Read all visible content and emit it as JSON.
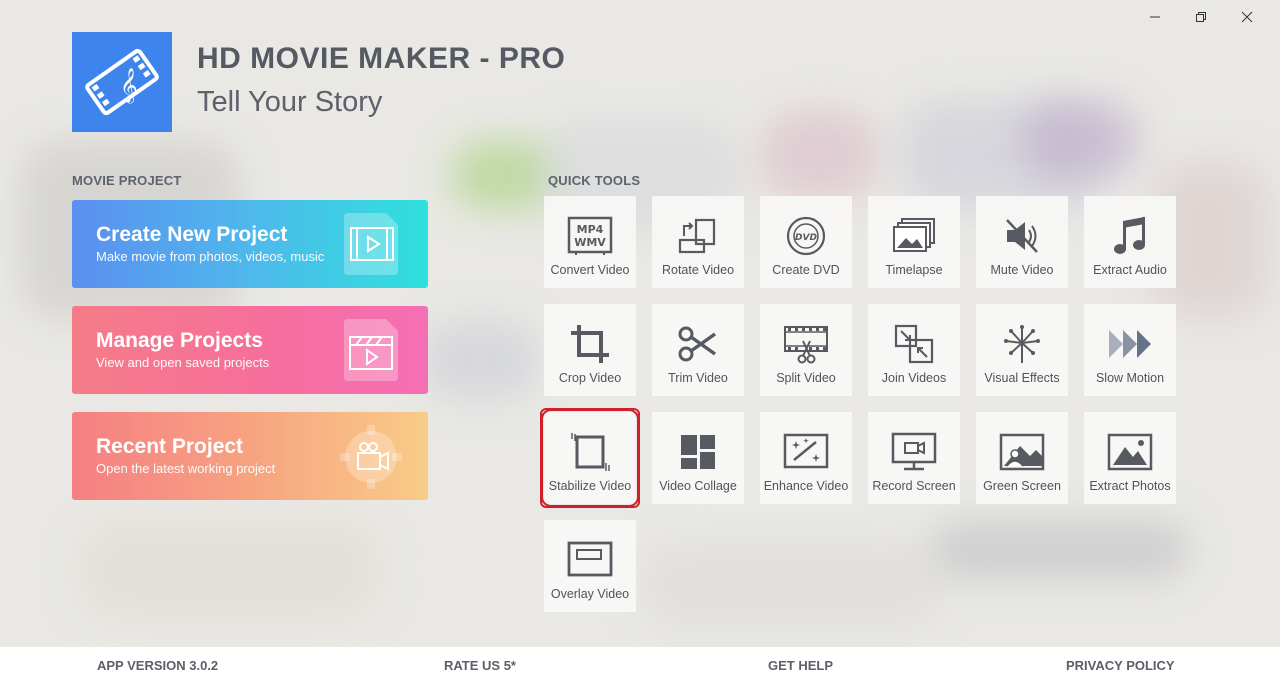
{
  "window": {
    "controls": [
      {
        "icon": "minimize-icon"
      },
      {
        "icon": "restore-icon"
      },
      {
        "icon": "close-icon"
      }
    ]
  },
  "app": {
    "logo_icon": "film-music-icon",
    "title": "HD MOVIE MAKER - PRO",
    "subtitle": "Tell Your Story"
  },
  "movie_project": {
    "label": "MOVIE PROJECT",
    "cards": [
      {
        "title": "Create New Project",
        "description": "Make movie from photos, videos, music",
        "icon": "video-clip-icon",
        "color_start": "#5a8ff0",
        "color_end": "#2fe0dc"
      },
      {
        "title": "Manage Projects",
        "description": "View and open saved projects",
        "icon": "clapperboard-icon",
        "color_start": "#f57c87",
        "color_end": "#f56fb4"
      },
      {
        "title": "Recent Project",
        "description": "Open the latest working project",
        "icon": "gear-camera-icon",
        "color_start": "#f67f83",
        "color_end": "#f8cc88"
      }
    ]
  },
  "quick_tools": {
    "label": "QUICK TOOLS",
    "selected": "Stabilize Video",
    "selected_color": "#d0202a",
    "tools": [
      {
        "label": "Convert Video",
        "icon": "mp4-wmv-icon"
      },
      {
        "label": "Rotate Video",
        "icon": "rotate-icon"
      },
      {
        "label": "Create DVD",
        "icon": "dvd-icon"
      },
      {
        "label": "Timelapse",
        "icon": "timelapse-icon"
      },
      {
        "label": "Mute Video",
        "icon": "mute-icon"
      },
      {
        "label": "Extract Audio",
        "icon": "music-note-icon"
      },
      {
        "label": "Crop Video",
        "icon": "crop-icon"
      },
      {
        "label": "Trim Video",
        "icon": "scissors-icon"
      },
      {
        "label": "Split Video",
        "icon": "film-split-icon"
      },
      {
        "label": "Join Videos",
        "icon": "join-icon"
      },
      {
        "label": "Visual Effects",
        "icon": "fireworks-icon"
      },
      {
        "label": "Slow Motion",
        "icon": "fast-forward-icon"
      },
      {
        "label": "Stabilize Video",
        "icon": "stabilize-icon"
      },
      {
        "label": "Video Collage",
        "icon": "collage-icon"
      },
      {
        "label": "Enhance Video",
        "icon": "magic-wand-icon"
      },
      {
        "label": "Record Screen",
        "icon": "monitor-camera-icon"
      },
      {
        "label": "Green Screen",
        "icon": "landscape-person-icon"
      },
      {
        "label": "Extract Photos",
        "icon": "image-icon"
      },
      {
        "label": "Overlay Video",
        "icon": "overlay-icon"
      }
    ]
  },
  "footer": {
    "version": "APP VERSION 3.0.2",
    "rate": "RATE US 5*",
    "help": "GET HELP",
    "privacy": "PRIVACY POLICY"
  }
}
